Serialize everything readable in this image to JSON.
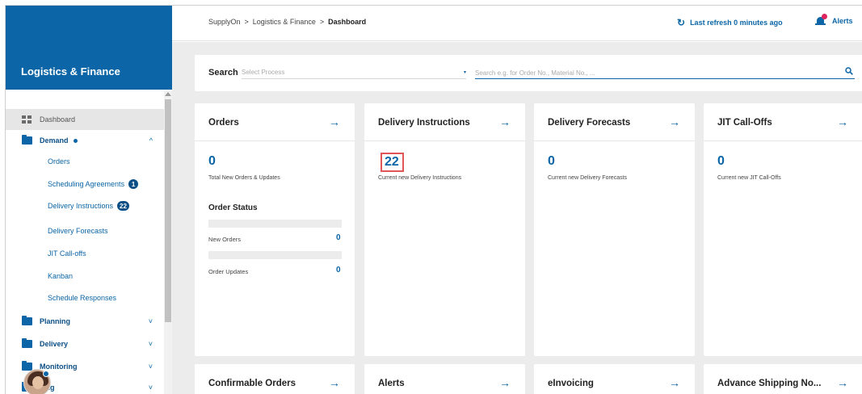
{
  "sidebar": {
    "title": "Logistics & Finance",
    "items": [
      {
        "label": "Dashboard"
      },
      {
        "label": "Demand",
        "chevron": "^"
      },
      {
        "label": "Planning",
        "chevron": "˅"
      },
      {
        "label": "Delivery",
        "chevron": "˅"
      },
      {
        "label": "Monitoring",
        "chevron": "˅"
      },
      {
        "label": "cing",
        "chevron": "˅"
      }
    ],
    "demand_sub": [
      {
        "label": "Orders",
        "badge": ""
      },
      {
        "label": "Scheduling Agreements",
        "badge": "1"
      },
      {
        "label": "Delivery Instructions",
        "badge": "22"
      },
      {
        "label": "Delivery Forecasts",
        "badge": ""
      },
      {
        "label": "JIT Call-offs",
        "badge": ""
      },
      {
        "label": "Kanban",
        "badge": ""
      },
      {
        "label": "Schedule Responses",
        "badge": ""
      }
    ]
  },
  "header": {
    "breadcrumb": [
      "SupplyOn",
      "Logistics & Finance",
      "Dashboard"
    ],
    "separator": ">",
    "refresh_icon": "↻",
    "refresh_label": "Last refresh 0 minutes ago",
    "alerts_label": "Alerts"
  },
  "search": {
    "label": "Search",
    "process_placeholder": "Select Process",
    "process_caret": "▾",
    "query_placeholder": "Search e.g. for Order No., Material No., ..."
  },
  "arrow": "→",
  "cards": {
    "orders": {
      "title": "Orders",
      "value": "0",
      "subtitle": "Total New Orders & Updates",
      "status_title": "Order Status",
      "status": [
        {
          "label": "New Orders",
          "value": "0"
        },
        {
          "label": "Order Updates",
          "value": "0"
        }
      ]
    },
    "delivery_instructions": {
      "title": "Delivery Instructions",
      "value": "22",
      "subtitle": "Current new Delivery Instructions"
    },
    "delivery_forecasts": {
      "title": "Delivery Forecasts",
      "value": "0",
      "subtitle": "Current new Delivery Forecasts"
    },
    "jit": {
      "title": "JIT Call-Offs",
      "value": "0",
      "subtitle": "Current new JIT Call-Offs"
    },
    "confirmable": {
      "title": "Confirmable Orders"
    },
    "alerts": {
      "title": "Alerts"
    },
    "einvoicing": {
      "title": "eInvoicing"
    },
    "asn": {
      "title": "Advance Shipping No..."
    }
  },
  "colors": {
    "brand": "#0b65a6",
    "highlight": "#e05555",
    "alert_dot": "#e0245e"
  }
}
